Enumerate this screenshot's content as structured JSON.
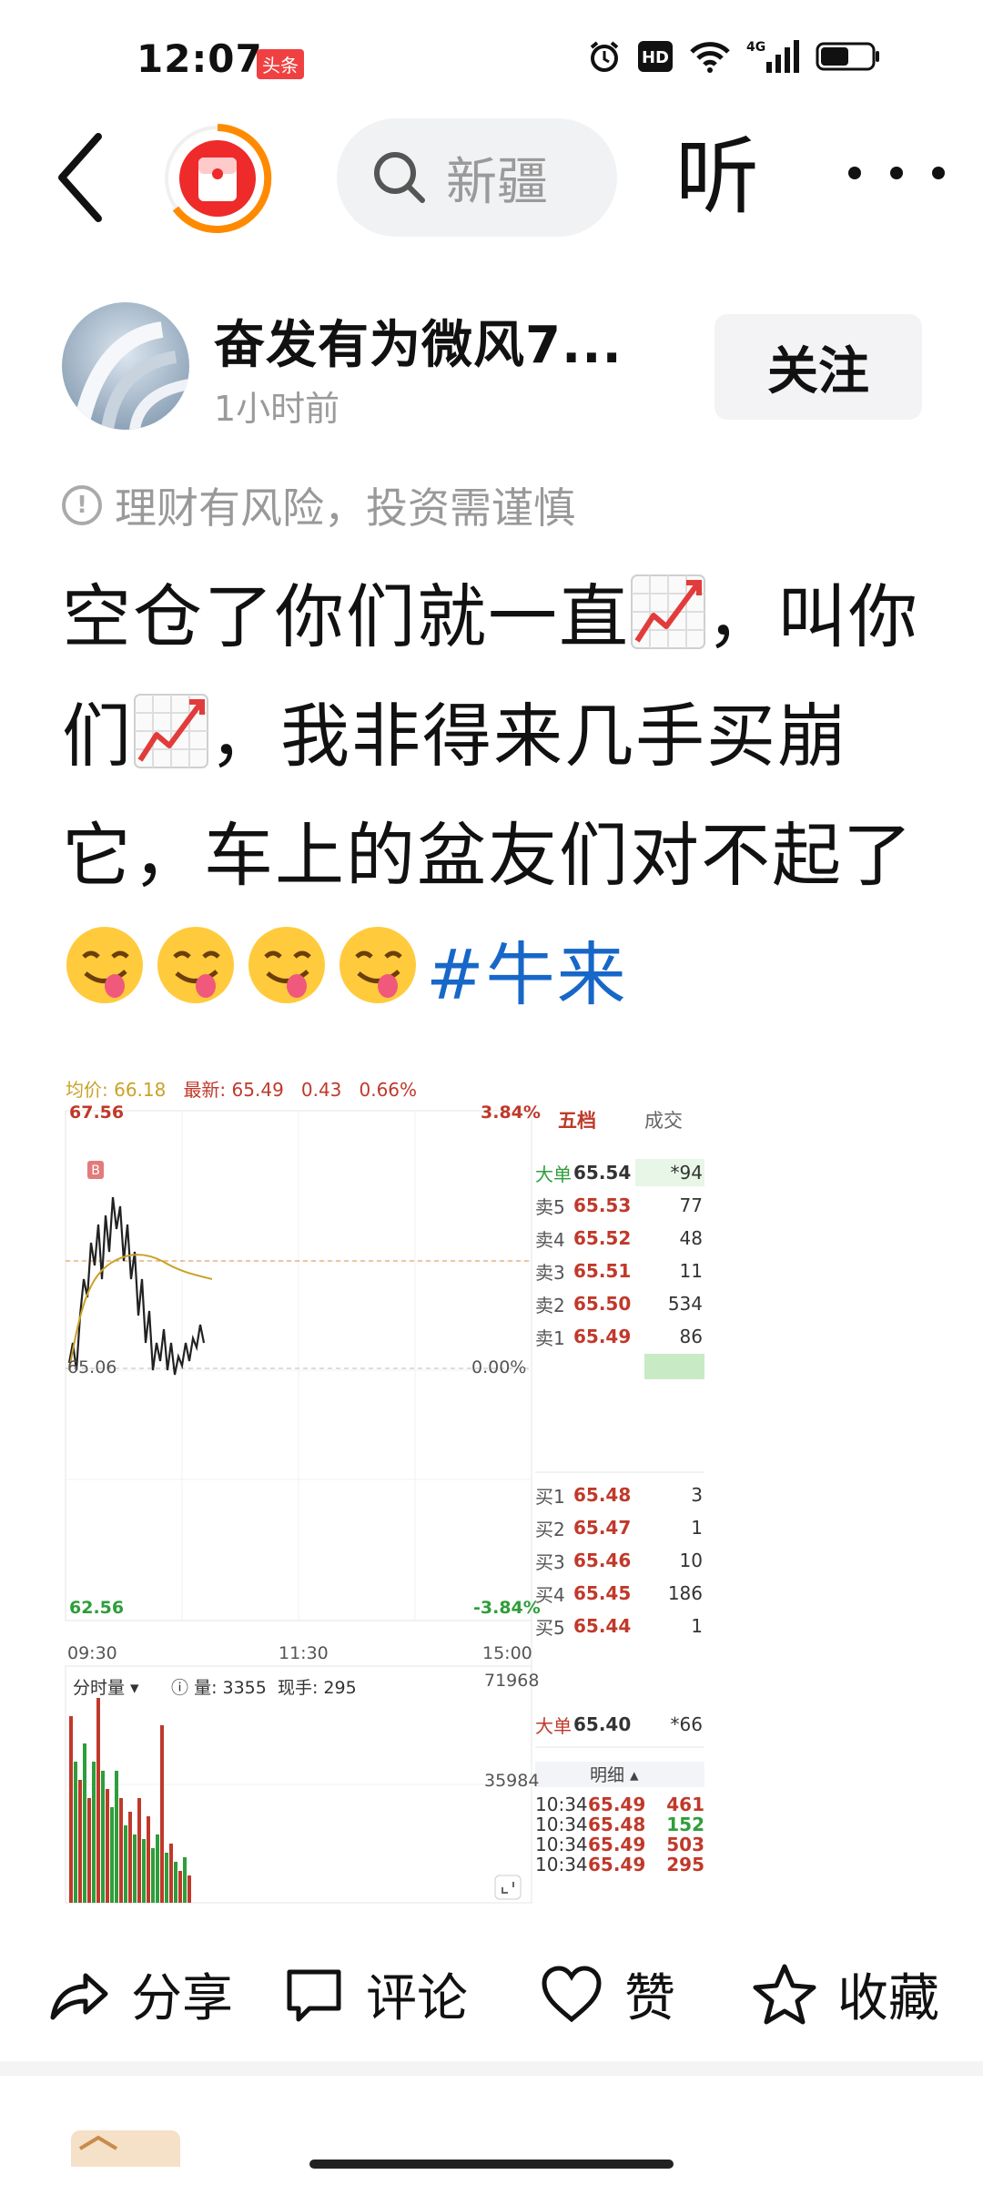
{
  "status_bar": {
    "time": "12:07",
    "app_badge": "头条",
    "network": "4G"
  },
  "nav": {
    "search_placeholder": "新疆",
    "listen_label": "听"
  },
  "post": {
    "author_name": "奋发有为微风7...",
    "time_ago": "1小时前",
    "follow_label": "关注",
    "risk_notice": "理财有风险，投资需谨慎",
    "text_part1": "空仓了你们就一直",
    "text_part2": "，叫你们",
    "text_part3": "，我非得来几手买崩它，车上的盆友们对不起了",
    "hashtag": "#牛来"
  },
  "stock_widget": {
    "header": {
      "avg_label": "均价: 66.18",
      "latest_label": "最新: 65.49",
      "change": "0.43",
      "change_pct": "0.66%"
    },
    "price_high": "67.56",
    "pct_high": "3.84%",
    "price_open": "65.06",
    "pct_zero": "0.00%",
    "price_low": "62.56",
    "pct_low": "-3.84%",
    "time_start": "09:30",
    "time_mid": "11:30",
    "time_end": "15:00",
    "volume_label": "分时量",
    "volume_value": "量: 3355",
    "current_hand": "现手: 295",
    "vol_max": "71968",
    "vol_mid": "35984",
    "tab_five": "五档",
    "tab_trade": "成交",
    "big_sell": {
      "label": "大单",
      "price": "65.54",
      "vol": "*94"
    },
    "sells": [
      {
        "label": "卖5",
        "price": "65.53",
        "vol": "77"
      },
      {
        "label": "卖4",
        "price": "65.52",
        "vol": "48"
      },
      {
        "label": "卖3",
        "price": "65.51",
        "vol": "11"
      },
      {
        "label": "卖2",
        "price": "65.50",
        "vol": "534"
      },
      {
        "label": "卖1",
        "price": "65.49",
        "vol": "86"
      }
    ],
    "buys": [
      {
        "label": "买1",
        "price": "65.48",
        "vol": "3"
      },
      {
        "label": "买2",
        "price": "65.47",
        "vol": "1"
      },
      {
        "label": "买3",
        "price": "65.46",
        "vol": "10"
      },
      {
        "label": "买4",
        "price": "65.45",
        "vol": "186"
      },
      {
        "label": "买5",
        "price": "65.44",
        "vol": "1"
      }
    ],
    "big_buy": {
      "label": "大单",
      "price": "65.40",
      "vol": "*66"
    },
    "detail_label": "明细",
    "ticks": [
      {
        "time": "10:34",
        "price": "65.49",
        "vol": "461",
        "color": "#c0392b"
      },
      {
        "time": "10:34",
        "price": "65.48",
        "vol": "152",
        "color": "#2e9e3a"
      },
      {
        "time": "10:34",
        "price": "65.49",
        "vol": "503",
        "color": "#c0392b"
      },
      {
        "time": "10:34",
        "price": "65.49",
        "vol": "295",
        "color": "#c0392b"
      }
    ]
  },
  "actions": {
    "share": "分享",
    "comment": "评论",
    "like": "赞",
    "favorite": "收藏"
  },
  "colors": {
    "up": "#c0392b",
    "down": "#2e9e3a",
    "link": "#1767c8",
    "avg_line": "#c9a227"
  }
}
